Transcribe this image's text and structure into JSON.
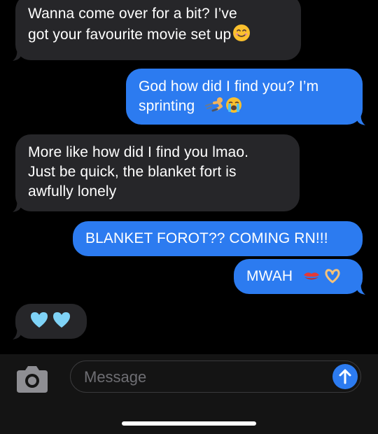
{
  "conversation": {
    "messages": [
      {
        "direction": "incoming",
        "lines": [
          "Wanna come over for a bit? I’ve",
          "got your favourite movie set up"
        ],
        "emoji": "smiling-face-icon"
      },
      {
        "direction": "outgoing",
        "lines": [
          "God how did I find you? I’m",
          "sprinting"
        ],
        "emoji": "running-and-crying-face-icons"
      },
      {
        "direction": "incoming",
        "lines": [
          "More like how did I find you lmao.",
          "Just be quick, the blanket fort is",
          "awfully lonely"
        ]
      },
      {
        "direction": "outgoing",
        "lines": [
          "BLANKET FOROT?? COMING RN!!!"
        ]
      },
      {
        "direction": "outgoing",
        "lines": [
          "MWAH"
        ],
        "emoji": "kiss-mark-and-heart-hands-icons"
      },
      {
        "direction": "incoming",
        "lines": [],
        "emoji": "two-light-blue-hearts-icons"
      }
    ]
  },
  "composer": {
    "placeholder": "Message",
    "camera_icon": "camera-icon",
    "send_icon": "arrow-up-icon"
  },
  "colors": {
    "background": "#000000",
    "incoming_bubble": "#262629",
    "outgoing_bubble": "#2c7bf0",
    "bottom_bar": "#141414",
    "placeholder_text": "#6e6e73"
  }
}
